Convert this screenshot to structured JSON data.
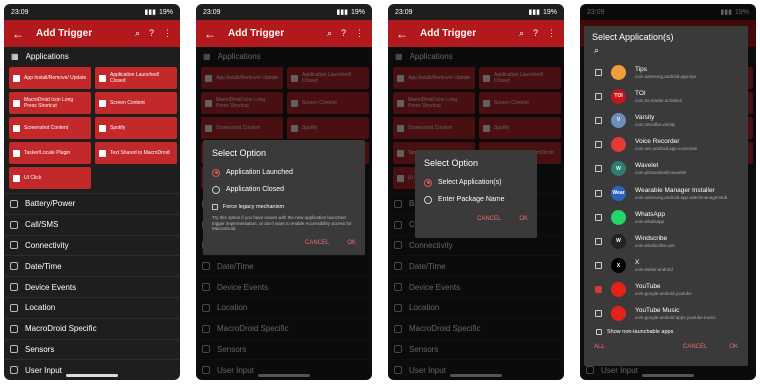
{
  "status": {
    "time": "23:09",
    "battery": "19%"
  },
  "topbar": {
    "title": "Add Trigger"
  },
  "section": {
    "applications": "Applications"
  },
  "tiles": [
    {
      "label": "App Install/Remove/ Update"
    },
    {
      "label": "Application Launched/ Closed"
    },
    {
      "label": "MacroDroid Icon Long Press Shortcut"
    },
    {
      "label": "Screen Content"
    },
    {
      "label": "Screenshot Content"
    },
    {
      "label": "Spotify"
    },
    {
      "label": "Tasker/Locale Plugin"
    },
    {
      "label": "Text Shared to MacroDroid"
    },
    {
      "label": "UI Click"
    }
  ],
  "categories": [
    "Battery/Power",
    "Call/SMS",
    "Connectivity",
    "Date/Time",
    "Device Events",
    "Location",
    "MacroDroid Specific",
    "Sensors",
    "User Input"
  ],
  "dialog1": {
    "title": "Select Option",
    "options": [
      "Application Launched",
      "Application Closed"
    ],
    "legacy": "Force legacy mechanism",
    "note": "Try this option if you have issues with the new application launched trigger implementation, or don't want to enable Accessibility access for MacroDroid.",
    "cancel": "CANCEL",
    "ok": "OK"
  },
  "dialog2": {
    "title": "Select Option",
    "options": [
      "Select Application(s)",
      "Enter Package Name"
    ],
    "cancel": "CANCEL",
    "ok": "OK"
  },
  "dialog3": {
    "title": "Select Application(s)",
    "apps": [
      {
        "name": "Tips",
        "pkg": "com.samsung.android.app.tips",
        "color": "#f29d38",
        "glyph": "",
        "checked": false
      },
      {
        "name": "TOI",
        "pkg": "com.toi.reader.activities",
        "color": "#c8141c",
        "glyph": "TOI",
        "checked": false
      },
      {
        "name": "Varsity",
        "pkg": "com.zerodha.varsity",
        "color": "#6e8fb8",
        "glyph": "V",
        "checked": false
      },
      {
        "name": "Voice Recorder",
        "pkg": "com.sec.android.app.voicenote",
        "color": "#e53935",
        "glyph": "",
        "checked": false
      },
      {
        "name": "Wavelet",
        "pkg": "com.pittvandewitt.wavelet",
        "color": "#2e7d6e",
        "glyph": "W",
        "checked": false
      },
      {
        "name": "Wearable Manager Installer",
        "pkg": "com.samsung.android.app.watchmanagerstub",
        "color": "#2b63c5",
        "glyph": "Wear",
        "checked": false
      },
      {
        "name": "WhatsApp",
        "pkg": "com.whatsapp",
        "color": "#25d366",
        "glyph": "",
        "checked": false
      },
      {
        "name": "Windscribe",
        "pkg": "com.windscribe.vpn",
        "color": "#222222",
        "glyph": "W",
        "checked": false
      },
      {
        "name": "X",
        "pkg": "com.twitter.android",
        "color": "#000000",
        "glyph": "X",
        "checked": false
      },
      {
        "name": "YouTube",
        "pkg": "com.google.android.youtube",
        "color": "#e62117",
        "glyph": "",
        "checked": true
      },
      {
        "name": "YouTube Music",
        "pkg": "com.google.android.apps.youtube.music",
        "color": "#e62117",
        "glyph": "",
        "checked": false
      }
    ],
    "show_non_launchable": "Show non-launchable apps",
    "all": "ALL",
    "cancel": "CANCEL",
    "ok": "OK"
  },
  "colors": {
    "accent": "#b3191c",
    "tile": "#c3282b",
    "dialog": "#3a3a3a",
    "button_text": "#ef6b6e"
  }
}
